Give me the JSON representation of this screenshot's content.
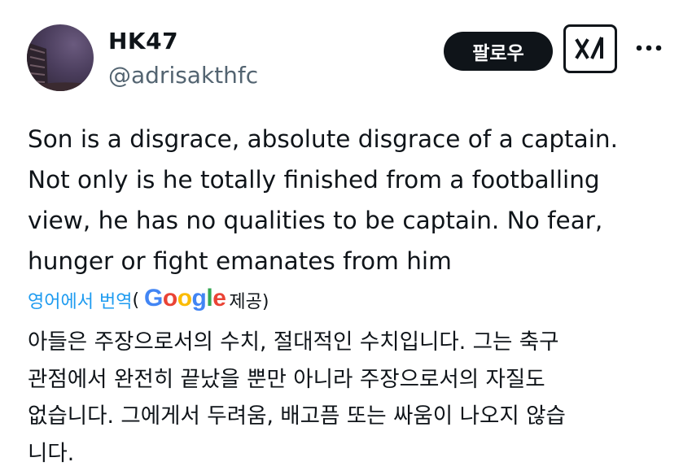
{
  "author": {
    "display_name": "HK47",
    "handle": "@adrisakthfc"
  },
  "actions": {
    "follow_label": "팔로우",
    "grok_icon": "grok-icon",
    "more_icon": "more-icon"
  },
  "tweet": {
    "text": "Son is a disgrace, absolute disgrace of a captain.\nNot only is he totally finished from a footballing\nview, he has no qualities to be captain. No fear,\nhunger or fight emanates from him"
  },
  "translation": {
    "link_label": "영어에서 번역",
    "open_paren": "(",
    "provider": "Google",
    "provider_suffix": "제공)",
    "text": "아들은 주장으로서의 수치, 절대적인 수치입니다. 그는 축구\n관점에서 완전히 끝났을 뿐만 아니라 주장으로서의 자질도\n없습니다. 그에게서 두려움, 배고픔 또는 싸움이 나오지 않습\n니다."
  },
  "colors": {
    "link": "#1d9bf0",
    "text": "#0f1419",
    "secondary": "#536471",
    "google_blue": "#4285F4",
    "google_red": "#EA4335",
    "google_yellow": "#FBBC05",
    "google_green": "#34A853"
  }
}
